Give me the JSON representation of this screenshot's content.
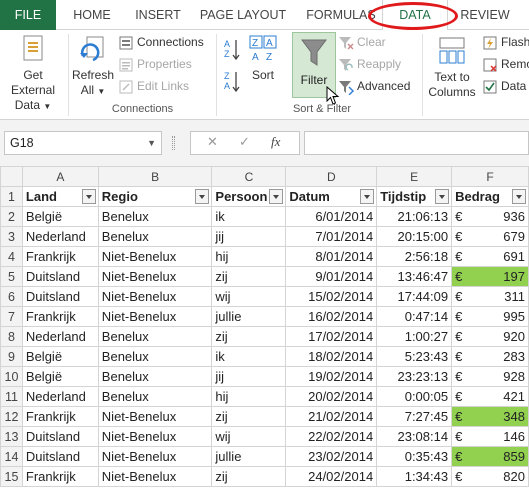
{
  "ribbon_tabs": [
    "FILE",
    "HOME",
    "INSERT",
    "PAGE LAYOUT",
    "FORMULAS",
    "DATA",
    "REVIEW"
  ],
  "active_tab": "DATA",
  "colors": {
    "accent": "#217346",
    "highlight_oval": "#e0191b",
    "cell_highlight": "#92d050",
    "filter_active_bg": "#d5e8d4"
  },
  "ribbon": {
    "get_external_data": [
      "Get External",
      "Data"
    ],
    "refresh_all": [
      "Refresh",
      "All"
    ],
    "connections": "Connections",
    "properties": "Properties",
    "edit_links": "Edit Links",
    "connections_group": "Connections",
    "sort": "Sort",
    "filter": "Filter",
    "clear": "Clear",
    "reapply": "Reapply",
    "advanced": "Advanced",
    "sort_filter_group": "Sort & Filter",
    "text_to_columns": [
      "Text to",
      "Columns"
    ],
    "flash": "Flash",
    "remo": "Remo",
    "data": "Data"
  },
  "formula_bar": {
    "name_box": "G18",
    "cancel": "✕",
    "enter": "✓",
    "fx": "fx",
    "value": ""
  },
  "columns": [
    "A",
    "B",
    "C",
    "D",
    "E",
    "F"
  ],
  "headers": [
    "Land",
    "Regio",
    "Persoon",
    "Datum",
    "Tijdstip",
    "Bedrag"
  ],
  "rows": [
    {
      "n": "2",
      "land": "België",
      "regio": "Benelux",
      "persoon": "ik",
      "datum": "6/01/2014",
      "tijd": "21:06:13",
      "eur": "€",
      "bedrag": "936",
      "hl": false
    },
    {
      "n": "3",
      "land": "Nederland",
      "regio": "Benelux",
      "persoon": "jij",
      "datum": "7/01/2014",
      "tijd": "20:15:00",
      "eur": "€",
      "bedrag": "679",
      "hl": false
    },
    {
      "n": "4",
      "land": "Frankrijk",
      "regio": "Niet-Benelux",
      "persoon": "hij",
      "datum": "8/01/2014",
      "tijd": "2:56:18",
      "eur": "€",
      "bedrag": "691",
      "hl": false
    },
    {
      "n": "5",
      "land": "Duitsland",
      "regio": "Niet-Benelux",
      "persoon": "zij",
      "datum": "9/01/2014",
      "tijd": "13:46:47",
      "eur": "€",
      "bedrag": "197",
      "hl": true
    },
    {
      "n": "6",
      "land": "Duitsland",
      "regio": "Niet-Benelux",
      "persoon": "wij",
      "datum": "15/02/2014",
      "tijd": "17:44:09",
      "eur": "€",
      "bedrag": "311",
      "hl": false
    },
    {
      "n": "7",
      "land": "Frankrijk",
      "regio": "Niet-Benelux",
      "persoon": "jullie",
      "datum": "16/02/2014",
      "tijd": "0:47:14",
      "eur": "€",
      "bedrag": "995",
      "hl": false
    },
    {
      "n": "8",
      "land": "Nederland",
      "regio": "Benelux",
      "persoon": "zij",
      "datum": "17/02/2014",
      "tijd": "1:00:27",
      "eur": "€",
      "bedrag": "920",
      "hl": false
    },
    {
      "n": "9",
      "land": "België",
      "regio": "Benelux",
      "persoon": "ik",
      "datum": "18/02/2014",
      "tijd": "5:23:43",
      "eur": "€",
      "bedrag": "283",
      "hl": false
    },
    {
      "n": "10",
      "land": "België",
      "regio": "Benelux",
      "persoon": "jij",
      "datum": "19/02/2014",
      "tijd": "23:23:13",
      "eur": "€",
      "bedrag": "928",
      "hl": false
    },
    {
      "n": "11",
      "land": "Nederland",
      "regio": "Benelux",
      "persoon": "hij",
      "datum": "20/02/2014",
      "tijd": "0:00:05",
      "eur": "€",
      "bedrag": "421",
      "hl": false
    },
    {
      "n": "12",
      "land": "Frankrijk",
      "regio": "Niet-Benelux",
      "persoon": "zij",
      "datum": "21/02/2014",
      "tijd": "7:27:45",
      "eur": "€",
      "bedrag": "348",
      "hl": true
    },
    {
      "n": "13",
      "land": "Duitsland",
      "regio": "Niet-Benelux",
      "persoon": "wij",
      "datum": "22/02/2014",
      "tijd": "23:08:14",
      "eur": "€",
      "bedrag": "146",
      "hl": false
    },
    {
      "n": "14",
      "land": "Duitsland",
      "regio": "Niet-Benelux",
      "persoon": "jullie",
      "datum": "23/02/2014",
      "tijd": "0:35:43",
      "eur": "€",
      "bedrag": "859",
      "hl": true
    },
    {
      "n": "15",
      "land": "Frankrijk",
      "regio": "Niet-Benelux",
      "persoon": "zij",
      "datum": "24/02/2014",
      "tijd": "1:34:43",
      "eur": "€",
      "bedrag": "820",
      "hl": false
    }
  ]
}
